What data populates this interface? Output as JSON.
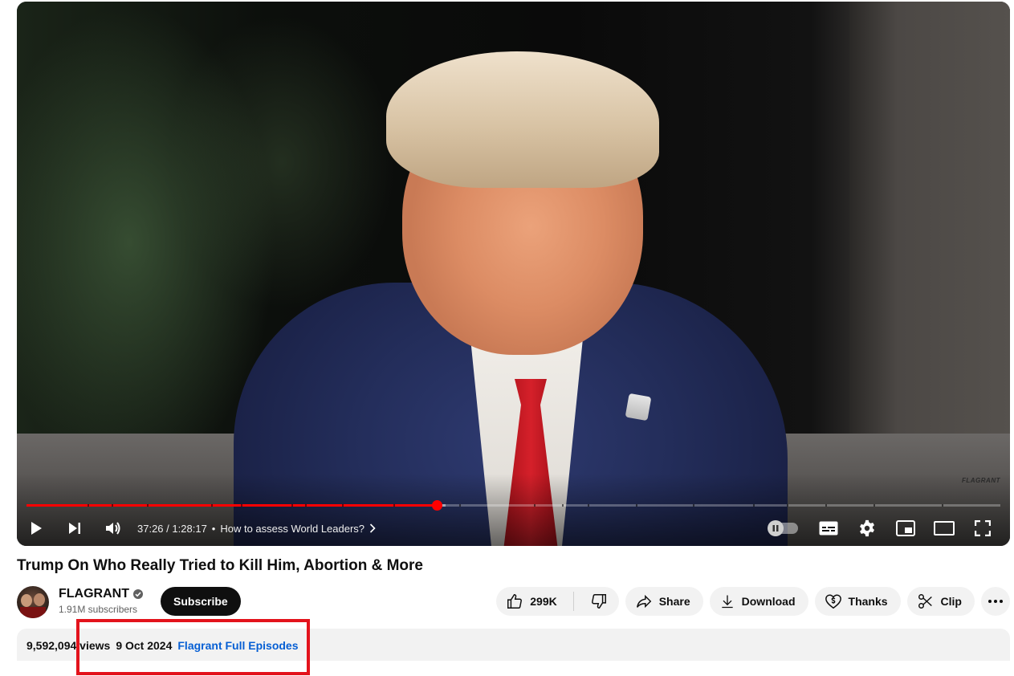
{
  "video": {
    "watermark": "FLAGRANT",
    "current_time": "37:26",
    "duration": "1:28:17",
    "time_separator": "/",
    "chapter_bullet": "•",
    "chapter_title": "How to assess World Leaders?",
    "progress_played": 0.4215,
    "progress_buffered": 0.43
  },
  "title": "Trump On Who Really Tried to Kill Him, Abortion & More",
  "channel": {
    "name": "FLAGRANT",
    "subscribers": "1.91M subscribers",
    "subscribe_label": "Subscribe"
  },
  "actions": {
    "likes": "299K",
    "share": "Share",
    "download": "Download",
    "thanks": "Thanks",
    "clip": "Clip"
  },
  "description": {
    "views": "9,592,094 views",
    "date": "9 Oct 2024",
    "hashtag": "Flagrant Full Episodes"
  },
  "colors": {
    "progress": "#ff0000",
    "highlight_box": "#e3131c",
    "link": "#065fd4"
  }
}
